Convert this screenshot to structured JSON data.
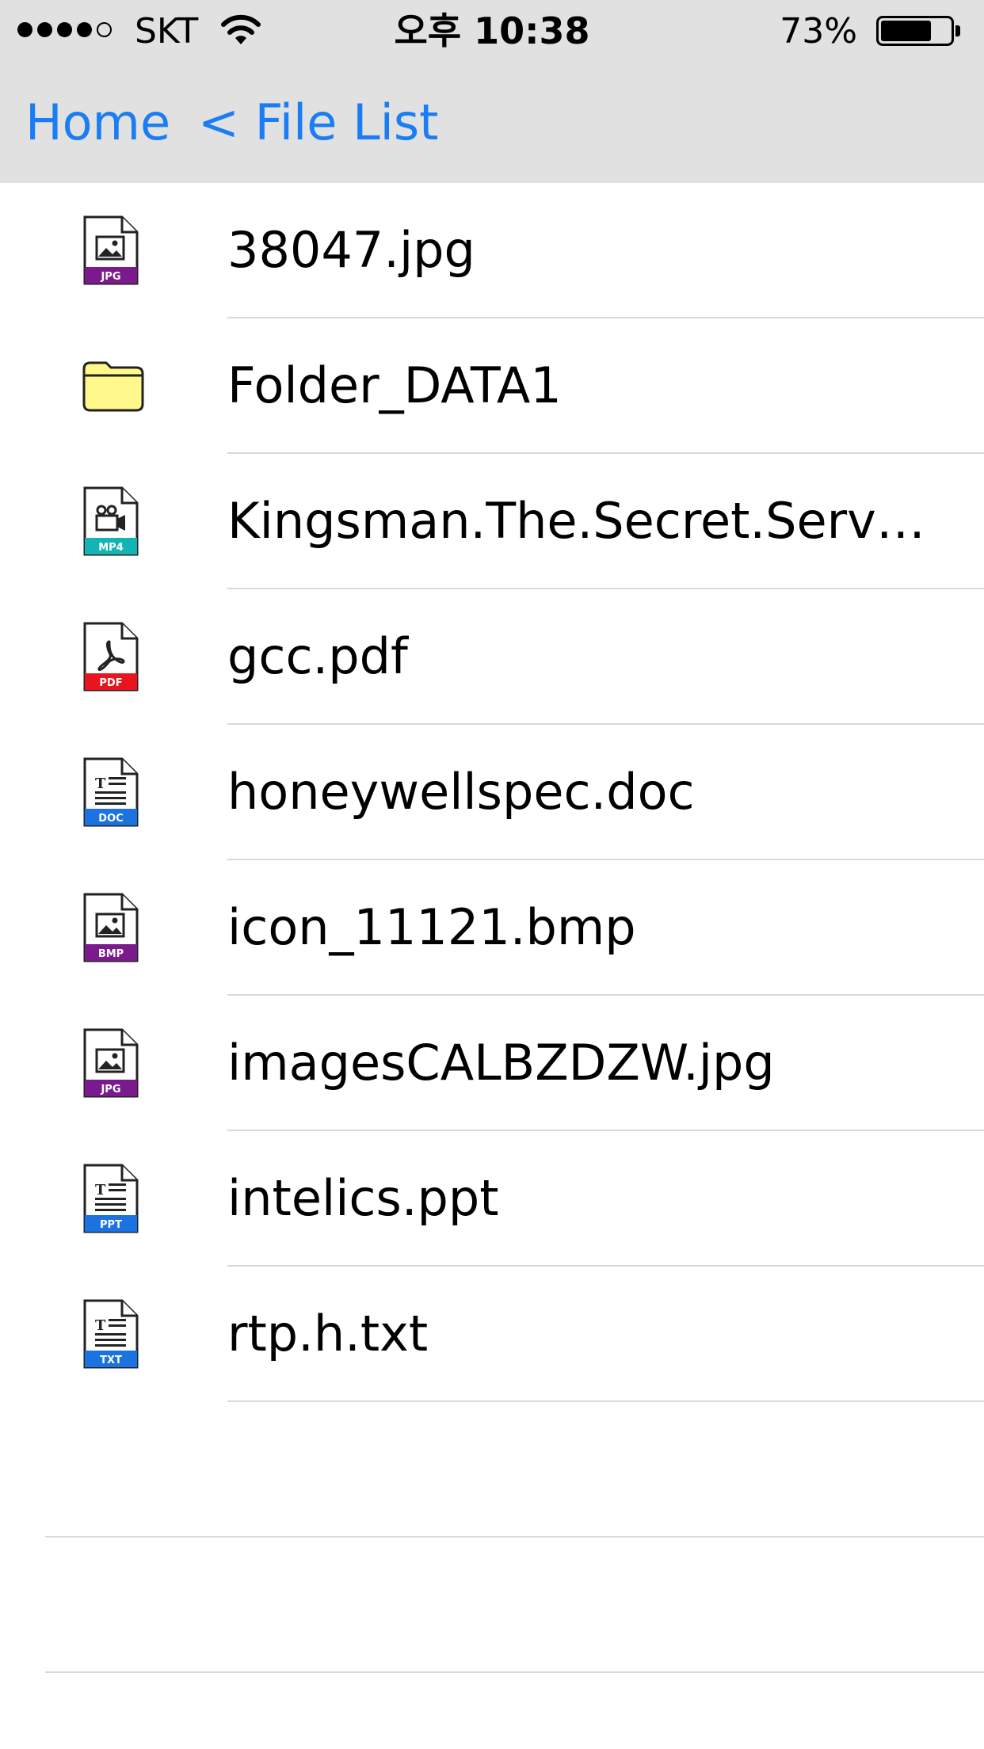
{
  "status_bar": {
    "carrier": "SKT",
    "signal_bars_filled": 4,
    "signal_bars_total": 5,
    "time": "오후 10:38",
    "battery_percent": "73%",
    "battery_level": 0.73
  },
  "nav": {
    "home_label": "Home",
    "back_label": "< File List",
    "accent_color": "#1a7df3"
  },
  "files": [
    {
      "name": "38047.jpg",
      "icon": "jpg-file-icon",
      "badge": "JPG",
      "badge_color": "#7b1a8c"
    },
    {
      "name": "Folder_DATA1",
      "icon": "folder-icon",
      "badge": "",
      "badge_color": "#fff88a"
    },
    {
      "name": "Kingsman.The.Secret.Servic...",
      "icon": "mp4-file-icon",
      "badge": "MP4",
      "badge_color": "#15b4b4"
    },
    {
      "name": "gcc.pdf",
      "icon": "pdf-file-icon",
      "badge": "PDF",
      "badge_color": "#e8141e"
    },
    {
      "name": "honeywellspec.doc",
      "icon": "doc-file-icon",
      "badge": "DOC",
      "badge_color": "#1a73e0"
    },
    {
      "name": "icon_11121.bmp",
      "icon": "bmp-file-icon",
      "badge": "BMP",
      "badge_color": "#7b1a8c"
    },
    {
      "name": "imagesCALBZDZW.jpg",
      "icon": "jpg-file-icon",
      "badge": "JPG",
      "badge_color": "#7b1a8c"
    },
    {
      "name": "intelics.ppt",
      "icon": "ppt-file-icon",
      "badge": "PPT",
      "badge_color": "#1a73e0"
    },
    {
      "name": "rtp.h.txt",
      "icon": "txt-file-icon",
      "badge": "TXT",
      "badge_color": "#1a73e0"
    }
  ]
}
